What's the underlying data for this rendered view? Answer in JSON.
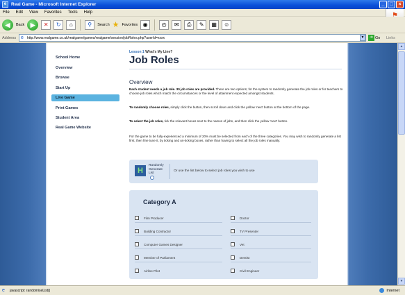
{
  "window": {
    "title": "Real Game - Microsoft Internet Explorer",
    "minimize": "_",
    "maximize": "□",
    "close": "×"
  },
  "menu": [
    "File",
    "Edit",
    "View",
    "Favorites",
    "Tools",
    "Help"
  ],
  "toolbar": {
    "back_label": "Back",
    "search_label": "Search",
    "favorites_label": "Favorites"
  },
  "address": {
    "label": "Address",
    "url": "http://www.realgame.co.uk/realgame/games/realgame/session/jobRoles.php?userId=xxxx",
    "go_label": "Go",
    "links_label": "Links"
  },
  "nav": {
    "items": [
      {
        "label": "School Home"
      },
      {
        "label": "Overview"
      },
      {
        "label": "Browse"
      },
      {
        "label": "Start Up"
      },
      {
        "label": "Live Game",
        "active": true
      },
      {
        "label": "Print Games"
      },
      {
        "label": "Student Area"
      },
      {
        "label": "Real Game Website"
      }
    ]
  },
  "content": {
    "breadcrumb_lead": "Lesson 1",
    "breadcrumb_tail": "What's My Line?",
    "title": "Job Roles",
    "overview_heading": "Overview",
    "p1_bold": "Each student needs a job role. 30 job roles are provided.",
    "p1_rest": " There are two options; for the system to randomly generate the job roles or for teachers to choose job roles which match the circumstances or the level of attainment expected amongst students.",
    "p2_bold": "To randomly choose roles,",
    "p2_rest": " simply click the button, then scroll down and click the yellow 'next' button at the bottom of the page.",
    "p3_bold": "To select the job roles,",
    "p3_rest": " tick the relevant boxes next to the names of jobs, and then click the yellow 'next' button.",
    "p4": "For the game to be fully-experienced a minimum of 20% must be selected from each of the three categories. You may wish to randomly generate a list first, then fine tune it, by ticking and un-ticking boxes, rather than having to select all the job roles manually.",
    "generate_label": "Randomly Generate List",
    "generate_alt": "Or use the list below to select job roles you wish to use"
  },
  "category_a": {
    "title": "Category A",
    "left": [
      "Film Producer",
      "Building Contractor",
      "Computer Games Designer",
      "Member of Parliament",
      "Airline Pilot"
    ],
    "right": [
      "Doctor",
      "TV Presenter",
      "Vet",
      "Dentist",
      "Civil Engineer"
    ]
  },
  "status": {
    "text": "javascript: randomiseList()",
    "zone": "Internet"
  },
  "colors": {
    "nav_active": "#5BB3E0",
    "title_bar": "#0A4FD8",
    "page_side": "#3C6BAA"
  }
}
